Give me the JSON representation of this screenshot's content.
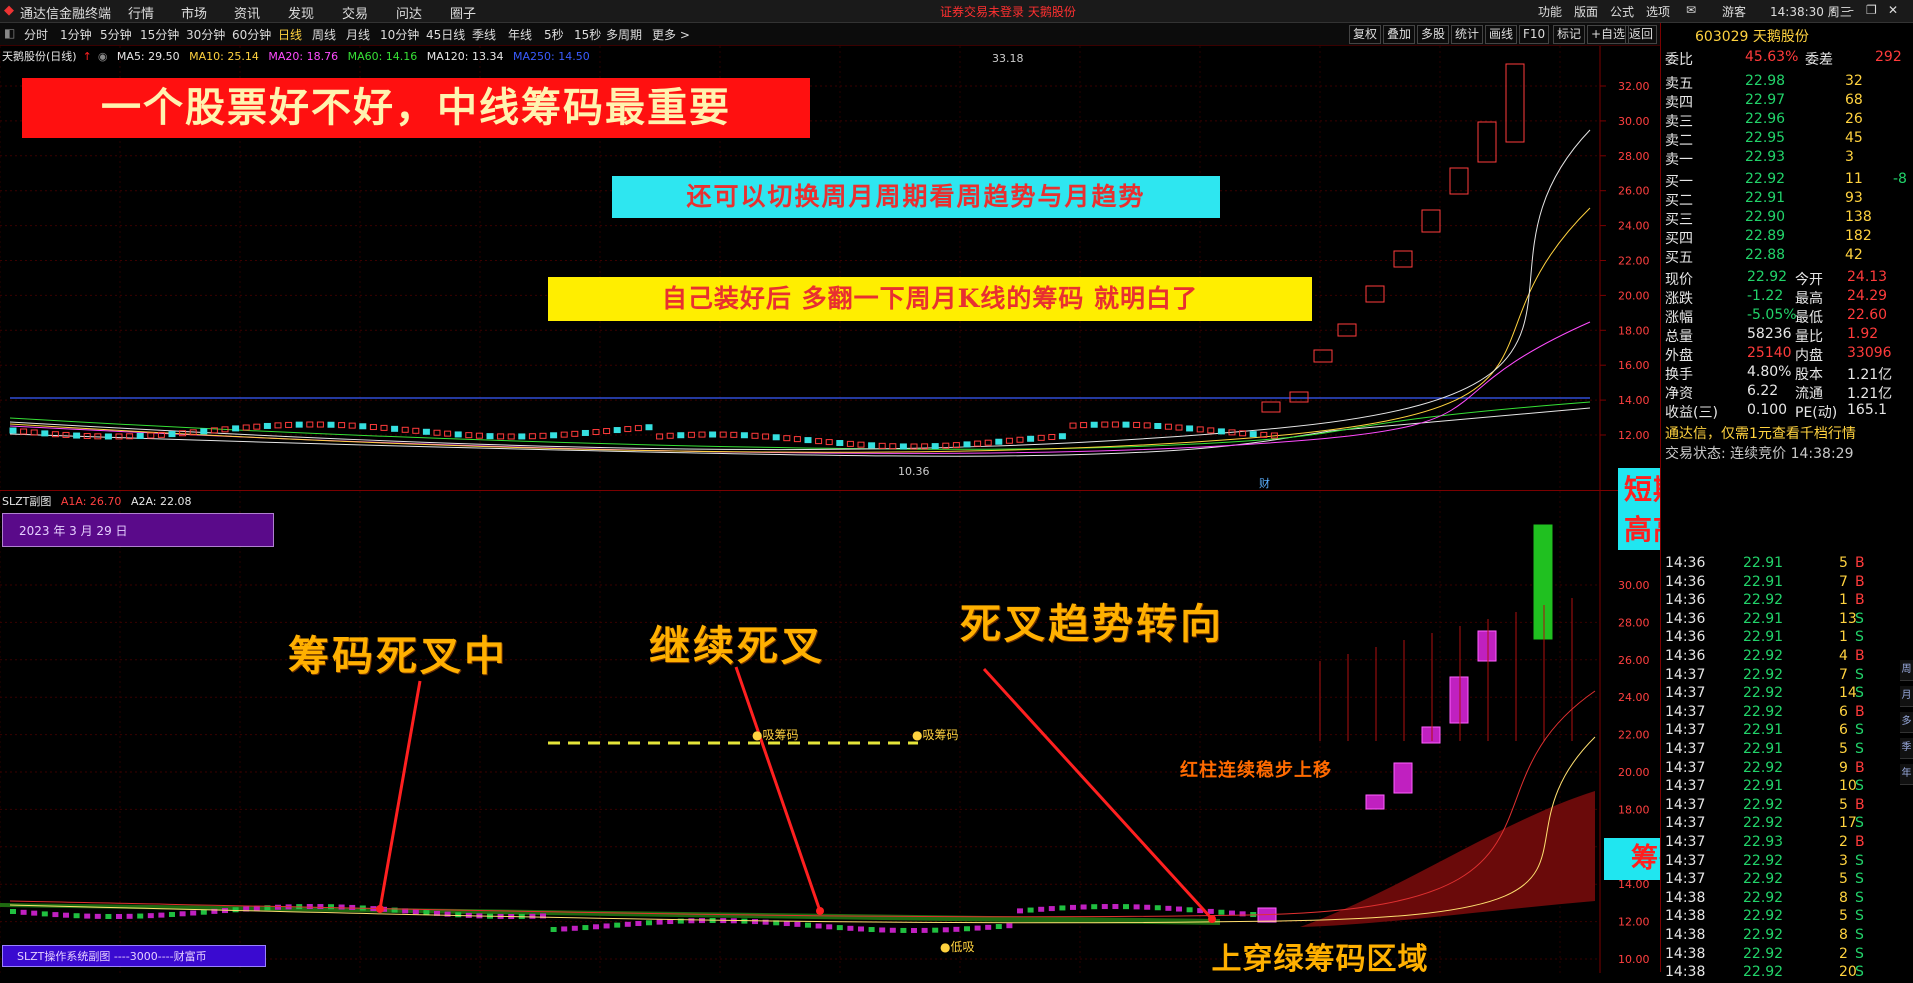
{
  "titlebar": {
    "app_name": "通达信金融终端",
    "menus": [
      "行情",
      "市场",
      "资讯",
      "发现",
      "交易",
      "问达",
      "圈子"
    ],
    "notice": "证券交易未登录   天鹅股份",
    "right_items": [
      "功能",
      "版面",
      "公式",
      "选项"
    ],
    "user": "游客",
    "clock": "14:38:30 周三"
  },
  "periodbar": {
    "tabs": [
      "分时",
      "1分钟",
      "5分钟",
      "15分钟",
      "30分钟",
      "60分钟",
      "日线",
      "周线",
      "月线",
      "10分钟",
      "45日线",
      "季线",
      "年线",
      "5秒",
      "15秒",
      "多周期",
      "更多 >"
    ],
    "active_tab": "日线",
    "tools": [
      "复权",
      "叠加",
      "多股",
      "统计",
      "画线",
      "F10",
      "标记",
      "+自选",
      "返回"
    ]
  },
  "main_chart": {
    "stock_title": "天鹅股份(日线)",
    "ma_legend": [
      {
        "label": "MA5: 29.50",
        "color": "#e6e6e6"
      },
      {
        "label": "MA10: 25.14",
        "color": "#ffd23f"
      },
      {
        "label": "MA20: 18.76",
        "color": "#ff4cff"
      },
      {
        "label": "MA60: 14.16",
        "color": "#36e036"
      },
      {
        "label": "MA120: 13.34",
        "color": "#e6e6e6"
      },
      {
        "label": "MA250: 14.50",
        "color": "#3a5cff"
      }
    ],
    "y_ticks": [
      "32.00",
      "30.00",
      "28.00",
      "26.00",
      "24.00",
      "22.00",
      "20.00",
      "18.00",
      "16.00",
      "14.00",
      "12.00"
    ],
    "high_label": "33.18",
    "low_label": "10.36",
    "event_label": "财",
    "banners": {
      "main_title": "一个股票好不好，中线筹码最重要",
      "cyan_note": "还可以切换周月周期看周趋势与月趋势",
      "yellow_note": "自己装好后   多翻一下周月K线的筹码   就明白了"
    }
  },
  "sub_chart": {
    "title": "SLZT副图",
    "a1a": "A1A: 26.70",
    "a2a": "A2A: 22.08",
    "date_box": "2023 年 3 月 29 日",
    "footer_box": "SLZT操作系统副图 ----3000----财富币",
    "y_ticks": [
      "30.00",
      "28.00",
      "26.00",
      "24.00",
      "22.00",
      "20.00",
      "18.00",
      "16.00",
      "14.00",
      "12.00",
      "10.00"
    ],
    "markers": [
      "●吸筹码",
      "●吸筹码",
      "●低吸"
    ],
    "annotations": {
      "dead_cross": "筹码死叉中",
      "continue_dead": "继续死叉",
      "trend_turn": "死叉趋势转向",
      "red_bars": "红柱连续稳步上移",
      "cross_green": "上穿绿筹码区域",
      "golden_cross": "筹码金叉强拉",
      "short_term": "短期涨幅过大，封高高抛"
    }
  },
  "quote_panel": {
    "code_name": "603029 天鹅股份",
    "wei_bi_label": "委比",
    "wei_bi": "45.63%",
    "wei_cha_label": "委差",
    "wei_cha": "292",
    "asks": [
      {
        "label": "卖五",
        "price": "22.98",
        "vol": "32"
      },
      {
        "label": "卖四",
        "price": "22.97",
        "vol": "68"
      },
      {
        "label": "卖三",
        "price": "22.96",
        "vol": "26"
      },
      {
        "label": "卖二",
        "price": "22.95",
        "vol": "45"
      },
      {
        "label": "卖一",
        "price": "22.93",
        "vol": "3"
      }
    ],
    "bids": [
      {
        "label": "买一",
        "price": "22.92",
        "vol": "11",
        "chg": "-8"
      },
      {
        "label": "买二",
        "price": "22.91",
        "vol": "93",
        "chg": ""
      },
      {
        "label": "买三",
        "price": "22.90",
        "vol": "138",
        "chg": ""
      },
      {
        "label": "买四",
        "price": "22.89",
        "vol": "182",
        "chg": ""
      },
      {
        "label": "买五",
        "price": "22.88",
        "vol": "42",
        "chg": ""
      }
    ],
    "stats": [
      {
        "l1": "现价",
        "v1": "22.92",
        "l2": "今开",
        "v2": "24.13"
      },
      {
        "l1": "涨跌",
        "v1": "-1.22",
        "l2": "最高",
        "v2": "24.29"
      },
      {
        "l1": "涨幅",
        "v1": "-5.05%",
        "l2": "最低",
        "v2": "22.60"
      },
      {
        "l1": "总量",
        "v1": "58236",
        "l2": "量比",
        "v2": "1.92"
      },
      {
        "l1": "外盘",
        "v1": "25140",
        "l2": "内盘",
        "v2": "33096"
      },
      {
        "l1": "换手",
        "v1": "4.80%",
        "l2": "股本",
        "v2": "1.21亿"
      },
      {
        "l1": "净资",
        "v1": "6.22",
        "l2": "流通",
        "v2": "1.21亿"
      },
      {
        "l1": "收益(三)",
        "v1": "0.100",
        "l2": "PE(动)",
        "v2": "165.1"
      }
    ],
    "ad_text": "通达信，仅需1元查看千档行情",
    "trade_status": "交易状态: 连续竞价 14:38:29",
    "ticks": [
      {
        "t": "14:36",
        "p": "22.91",
        "v": "5",
        "s": "B"
      },
      {
        "t": "14:36",
        "p": "22.91",
        "v": "7",
        "s": "B"
      },
      {
        "t": "14:36",
        "p": "22.92",
        "v": "1",
        "s": "B"
      },
      {
        "t": "14:36",
        "p": "22.91",
        "v": "13",
        "s": "S"
      },
      {
        "t": "14:36",
        "p": "22.91",
        "v": "1",
        "s": "S"
      },
      {
        "t": "14:36",
        "p": "22.92",
        "v": "4",
        "s": "B"
      },
      {
        "t": "14:37",
        "p": "22.92",
        "v": "7",
        "s": "S"
      },
      {
        "t": "14:37",
        "p": "22.92",
        "v": "14",
        "s": "S"
      },
      {
        "t": "14:37",
        "p": "22.92",
        "v": "6",
        "s": "B"
      },
      {
        "t": "14:37",
        "p": "22.91",
        "v": "6",
        "s": "S"
      },
      {
        "t": "14:37",
        "p": "22.91",
        "v": "5",
        "s": "S"
      },
      {
        "t": "14:37",
        "p": "22.92",
        "v": "9",
        "s": "B"
      },
      {
        "t": "14:37",
        "p": "22.91",
        "v": "10",
        "s": "S"
      },
      {
        "t": "14:37",
        "p": "22.92",
        "v": "5",
        "s": "B"
      },
      {
        "t": "14:37",
        "p": "22.92",
        "v": "17",
        "s": "S"
      },
      {
        "t": "14:37",
        "p": "22.93",
        "v": "2",
        "s": "B"
      },
      {
        "t": "14:37",
        "p": "22.92",
        "v": "3",
        "s": "S"
      },
      {
        "t": "14:37",
        "p": "22.92",
        "v": "5",
        "s": "S"
      },
      {
        "t": "14:38",
        "p": "22.92",
        "v": "8",
        "s": "S"
      },
      {
        "t": "14:38",
        "p": "22.92",
        "v": "5",
        "s": "S"
      },
      {
        "t": "14:38",
        "p": "22.92",
        "v": "8",
        "s": "S"
      },
      {
        "t": "14:38",
        "p": "22.92",
        "v": "2",
        "s": "S"
      },
      {
        "t": "14:38",
        "p": "22.92",
        "v": "20",
        "s": "S"
      }
    ]
  },
  "side_strip": [
    "周",
    "月",
    "多",
    "季",
    "年"
  ]
}
